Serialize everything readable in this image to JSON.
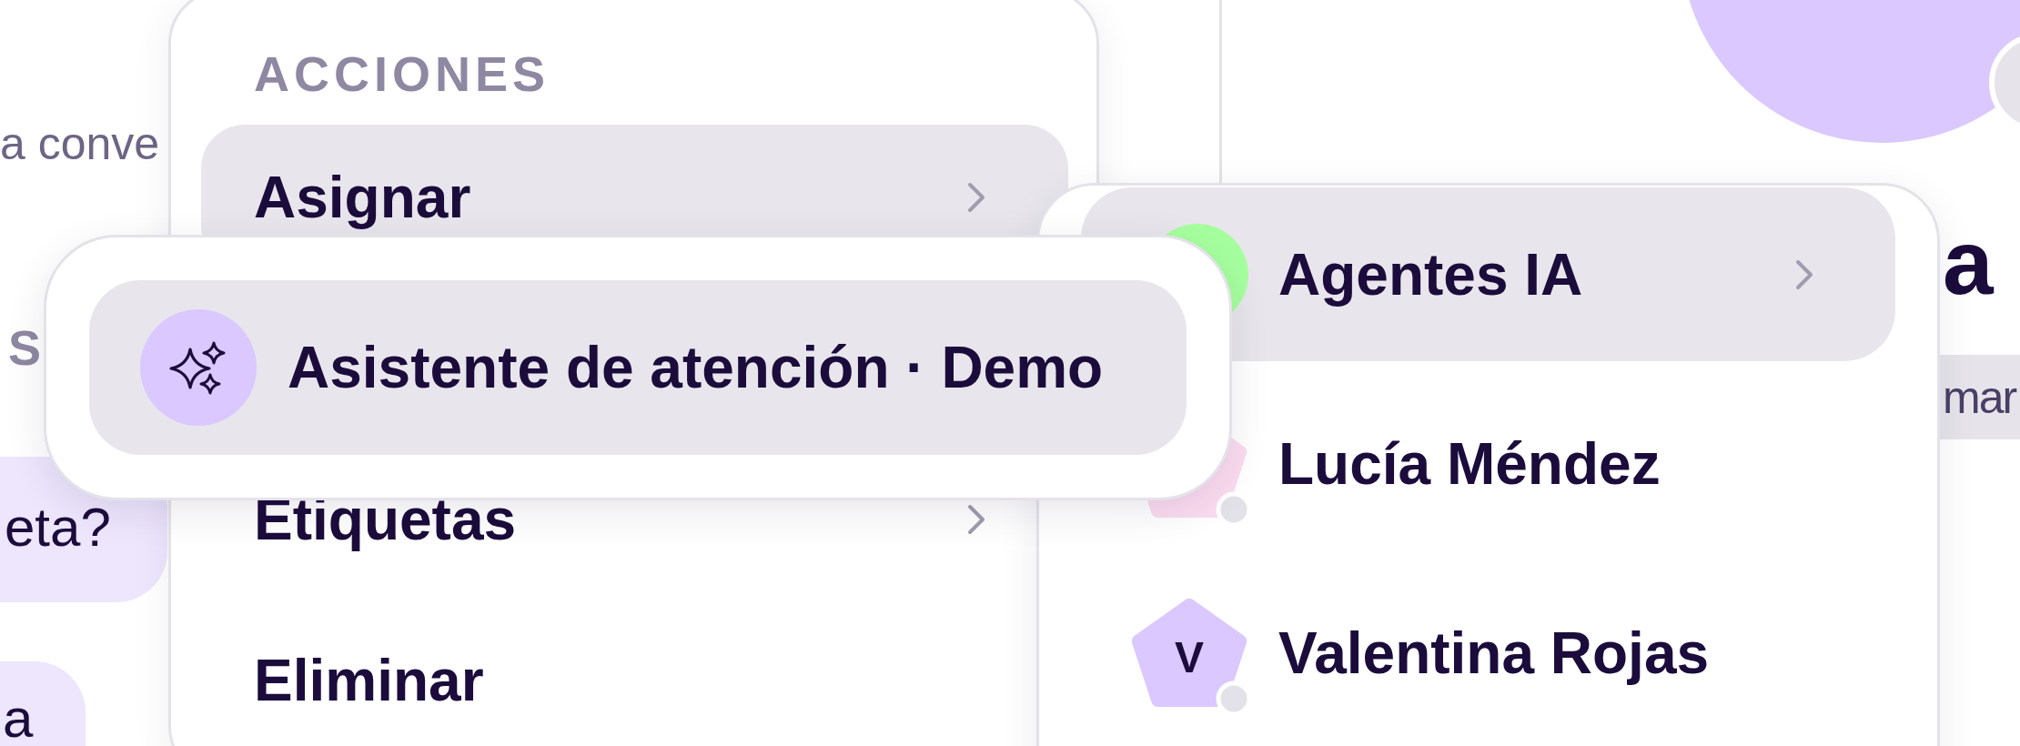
{
  "background": {
    "list_snippet": "a conve",
    "section_label": "S",
    "messages": [
      "eta?",
      "a"
    ]
  },
  "contact_panel": {
    "name": "a",
    "tag": "mar"
  },
  "actions_menu": {
    "header": "ACCIONES",
    "items": [
      {
        "label": "Asignar",
        "selected": true,
        "submenu": true
      },
      {
        "label": "Etiquetas",
        "selected": false,
        "submenu": true
      },
      {
        "label": "Eliminar",
        "selected": false,
        "submenu": false
      }
    ]
  },
  "assign_menu": {
    "items": [
      {
        "kind": "group",
        "label": "Agentes IA",
        "color": "#a6ff9e",
        "selected": true,
        "submenu": true
      },
      {
        "kind": "person",
        "label": "Lucía Méndez",
        "color": "#fbdcf0",
        "online": false,
        "selected": false,
        "submenu": false
      },
      {
        "kind": "person",
        "label": "Valentina Rojas",
        "initial": "V",
        "color": "#dac8ff",
        "online": false,
        "selected": false,
        "submenu": false
      }
    ]
  },
  "agent_menu": {
    "items": [
      {
        "label": "Asistente de atención · Demo",
        "selected": true
      }
    ]
  }
}
